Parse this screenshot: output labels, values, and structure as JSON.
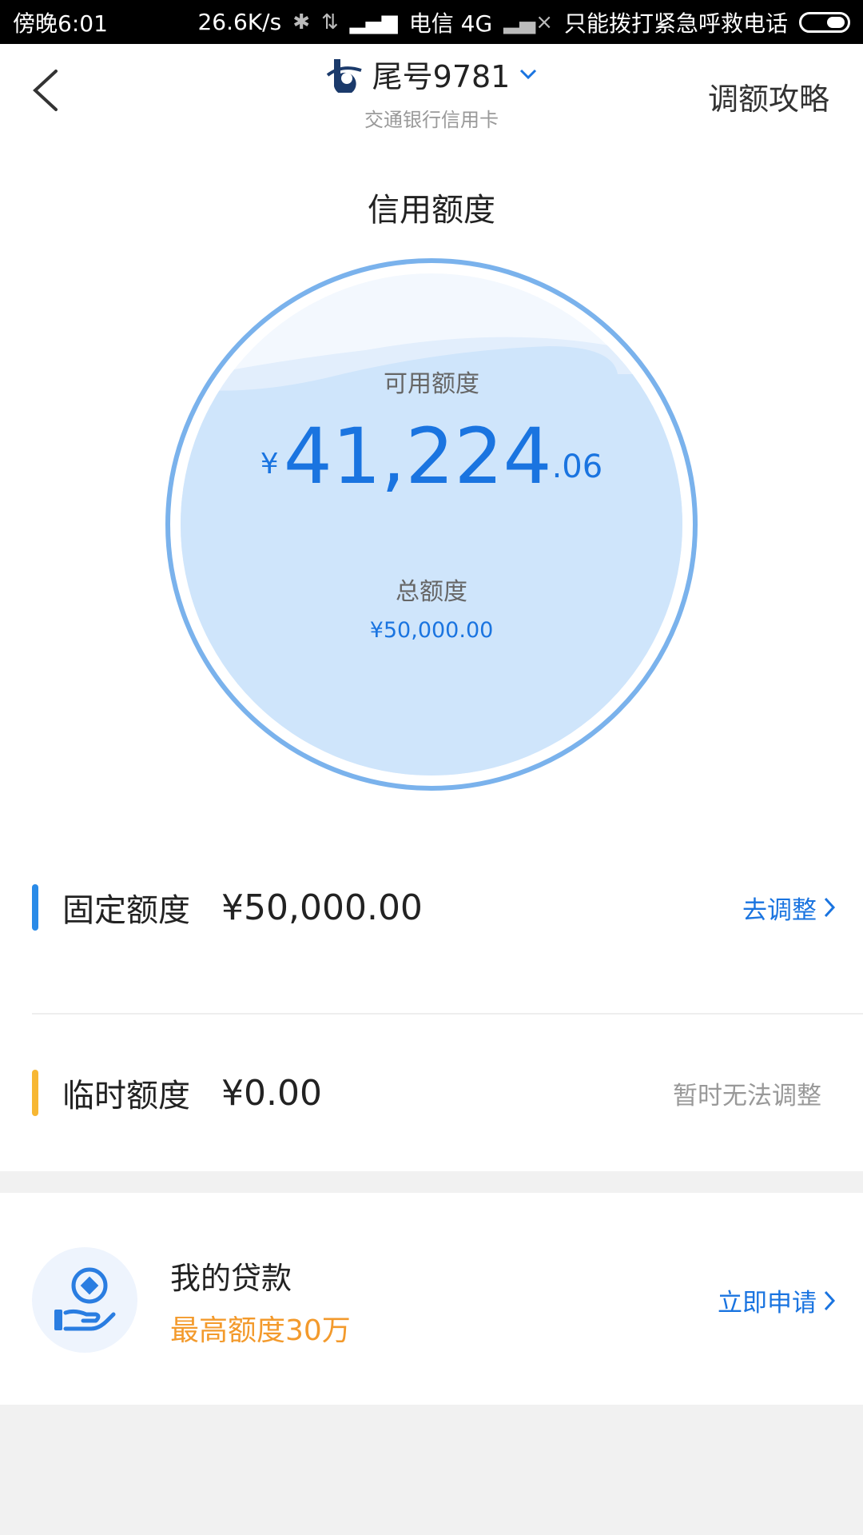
{
  "status_bar": {
    "time": "傍晚6:01",
    "net_speed": "26.6K/s",
    "carrier": "电信 4G",
    "emergency": "只能拨打紧急呼救电话"
  },
  "header": {
    "title": "尾号9781",
    "subtitle": "交通银行信用卡",
    "guide_link": "调额攻略"
  },
  "credit": {
    "section_title": "信用额度",
    "available_label": "可用额度",
    "available_currency": "¥",
    "available_integer": "41,224",
    "available_decimal": ".06",
    "total_label": "总额度",
    "total_value": "¥50,000.00"
  },
  "fixed_limit": {
    "label": "固定额度",
    "value": "¥50,000.00",
    "action": "去调整"
  },
  "temp_limit": {
    "label": "临时额度",
    "value": "¥0.00",
    "action": "暂时无法调整"
  },
  "loan": {
    "title": "我的贷款",
    "subtitle": "最高额度30万",
    "action": "立即申请"
  },
  "colors": {
    "accent": "#1a74e0",
    "circle_fill": "#cfe5fb",
    "circle_ring": "#7ab2ec",
    "fixed_bar": "#2a8be8",
    "temp_bar": "#f7b733",
    "loan_sub": "#f39a2c"
  }
}
